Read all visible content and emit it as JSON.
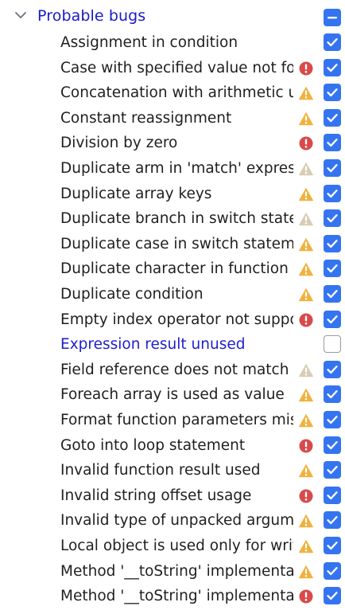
{
  "group": {
    "label": "Probable bugs",
    "state": "mixed",
    "icon": "chevron-down-icon"
  },
  "colors": {
    "accent": "#3574f0",
    "modified_text": "#1e1ed0",
    "error": "#d94a4a",
    "warning": "#f0b23c",
    "weak_warning": "#d8cdb4"
  },
  "items": [
    {
      "label": "Assignment in condition",
      "severity": "none",
      "checked": true,
      "modified": false
    },
    {
      "label": "Case with specified value not fo",
      "severity": "error",
      "checked": true,
      "modified": false
    },
    {
      "label": "Concatenation with arithmetic u",
      "severity": "warning",
      "checked": true,
      "modified": false
    },
    {
      "label": "Constant reassignment",
      "severity": "warning",
      "checked": true,
      "modified": false
    },
    {
      "label": "Division by zero",
      "severity": "error",
      "checked": true,
      "modified": false
    },
    {
      "label": "Duplicate arm in 'match' express",
      "severity": "weak-warning",
      "checked": true,
      "modified": false
    },
    {
      "label": "Duplicate array keys",
      "severity": "warning",
      "checked": true,
      "modified": false
    },
    {
      "label": "Duplicate branch in switch state",
      "severity": "weak-warning",
      "checked": true,
      "modified": false
    },
    {
      "label": "Duplicate case in switch stateme",
      "severity": "warning",
      "checked": true,
      "modified": false
    },
    {
      "label": "Duplicate character in function c",
      "severity": "warning",
      "checked": true,
      "modified": false
    },
    {
      "label": "Duplicate condition",
      "severity": "warning",
      "checked": true,
      "modified": false
    },
    {
      "label": "Empty index operator not suppo",
      "severity": "error",
      "checked": true,
      "modified": false
    },
    {
      "label": "Expression result unused",
      "severity": "none",
      "checked": false,
      "modified": true
    },
    {
      "label": "Field reference does not match c",
      "severity": "weak-warning",
      "checked": true,
      "modified": false
    },
    {
      "label": "Foreach array is used as value",
      "severity": "warning",
      "checked": true,
      "modified": false
    },
    {
      "label": "Format function parameters mis",
      "severity": "warning",
      "checked": true,
      "modified": false
    },
    {
      "label": "Goto into loop statement",
      "severity": "error",
      "checked": true,
      "modified": false
    },
    {
      "label": "Invalid function result used",
      "severity": "warning",
      "checked": true,
      "modified": false
    },
    {
      "label": "Invalid string offset usage",
      "severity": "error",
      "checked": true,
      "modified": false
    },
    {
      "label": "Invalid type of unpacked argume",
      "severity": "warning",
      "checked": true,
      "modified": false
    },
    {
      "label": "Local object is used only for writ",
      "severity": "warning",
      "checked": true,
      "modified": false
    },
    {
      "label": "Method '__toString' implementat",
      "severity": "warning",
      "checked": true,
      "modified": false
    },
    {
      "label": "Method '__toString' implementat",
      "severity": "error",
      "checked": true,
      "modified": false
    }
  ]
}
